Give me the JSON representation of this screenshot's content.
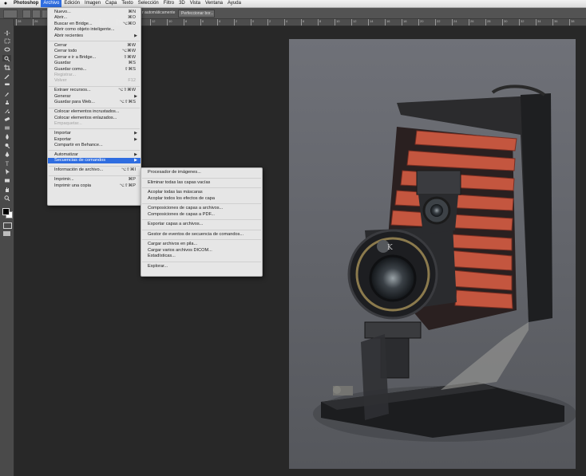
{
  "menubar": {
    "items": [
      "Photoshop",
      "Archivo",
      "Edición",
      "Imagen",
      "Capa",
      "Texto",
      "Selección",
      "Filtro",
      "3D",
      "Vista",
      "Ventana",
      "Ayuda"
    ],
    "active": "Archivo"
  },
  "options_bar": {
    "auto_label": "r automáticamente",
    "refine_button": "Perfeccionar bor..."
  },
  "ruler": {
    "ticks": [
      "28",
      "26",
      "24",
      "22",
      "20",
      "18",
      "16",
      "14",
      "12",
      "10",
      "8",
      "6",
      "4",
      "2",
      "0",
      "2",
      "4",
      "6",
      "8",
      "10",
      "12",
      "14",
      "16",
      "18",
      "20",
      "22",
      "24",
      "26",
      "28",
      "30",
      "32",
      "34",
      "36",
      "38"
    ]
  },
  "archivo_menu": {
    "items": [
      {
        "label": "Nuevo...",
        "shortcut": "⌘N"
      },
      {
        "label": "Abrir...",
        "shortcut": "⌘O"
      },
      {
        "label": "Buscar en Bridge...",
        "shortcut": "⌥⌘O"
      },
      {
        "label": "Abrir como objeto inteligente...",
        "shortcut": ""
      },
      {
        "label": "Abrir recientes",
        "submenu": true
      },
      {
        "sep": true
      },
      {
        "label": "Cerrar",
        "shortcut": "⌘W"
      },
      {
        "label": "Cerrar todo",
        "shortcut": "⌥⌘W"
      },
      {
        "label": "Cerrar e ir a Bridge...",
        "shortcut": "⇧⌘W"
      },
      {
        "label": "Guardar",
        "shortcut": "⌘S"
      },
      {
        "label": "Guardar como...",
        "shortcut": "⇧⌘S"
      },
      {
        "label": "Registrar...",
        "shortcut": "",
        "disabled": true
      },
      {
        "label": "Volver",
        "shortcut": "F12",
        "disabled": true
      },
      {
        "sep": true
      },
      {
        "label": "Extraer recursos...",
        "shortcut": "⌥⇧⌘W"
      },
      {
        "label": "Generar",
        "submenu": true
      },
      {
        "label": "Guardar para Web...",
        "shortcut": "⌥⇧⌘S"
      },
      {
        "sep": true
      },
      {
        "label": "Colocar elementos incrustados...",
        "shortcut": ""
      },
      {
        "label": "Colocar elementos enlazados...",
        "shortcut": ""
      },
      {
        "label": "Empaquetar...",
        "shortcut": "",
        "disabled": true
      },
      {
        "sep": true
      },
      {
        "label": "Importar",
        "submenu": true
      },
      {
        "label": "Exportar",
        "submenu": true
      },
      {
        "label": "Compartir en Behance...",
        "shortcut": ""
      },
      {
        "sep": true
      },
      {
        "label": "Automatizar",
        "submenu": true
      },
      {
        "label": "Secuencias de comandos",
        "submenu": true,
        "highlight": true
      },
      {
        "sep": true
      },
      {
        "label": "Información de archivo...",
        "shortcut": "⌥⇧⌘I"
      },
      {
        "sep": true
      },
      {
        "label": "Imprimir...",
        "shortcut": "⌘P"
      },
      {
        "label": "Imprimir una copia",
        "shortcut": "⌥⇧⌘P"
      }
    ]
  },
  "scripts_menu": {
    "items": [
      {
        "label": "Procesador de imágenes..."
      },
      {
        "sep": true
      },
      {
        "label": "Eliminar todas las capas vacías"
      },
      {
        "sep": true
      },
      {
        "label": "Acoplar todas las máscaras"
      },
      {
        "label": "Acoplar todos los efectos de capa"
      },
      {
        "sep": true
      },
      {
        "label": "Composiciones de capas a archivos..."
      },
      {
        "label": "Composiciones de capas a PDF..."
      },
      {
        "sep": true
      },
      {
        "label": "Exportar capas a archivos..."
      },
      {
        "sep": true
      },
      {
        "label": "Gestor de eventos de secuencia de comandos..."
      },
      {
        "sep": true
      },
      {
        "label": "Cargar archivos en pila..."
      },
      {
        "label": "Cargar varios archivos DICOM..."
      },
      {
        "label": "Estadísticas..."
      },
      {
        "sep": true
      },
      {
        "label": "Explorar..."
      }
    ]
  },
  "colors": {
    "menu_highlight": "#2f6de0",
    "workspace": "#282828",
    "panel": "#4a4a4a",
    "bellows": "#c4563f"
  },
  "tools": [
    "move-tool",
    "marquee-tool",
    "lasso-tool",
    "quick-selection-tool",
    "crop-tool",
    "eyedropper-tool",
    "healing-brush-tool",
    "brush-tool",
    "clone-stamp-tool",
    "history-brush-tool",
    "eraser-tool",
    "gradient-tool",
    "blur-tool",
    "dodge-tool",
    "pen-tool",
    "type-tool",
    "path-selection-tool",
    "rectangle-tool",
    "hand-tool",
    "zoom-tool"
  ]
}
